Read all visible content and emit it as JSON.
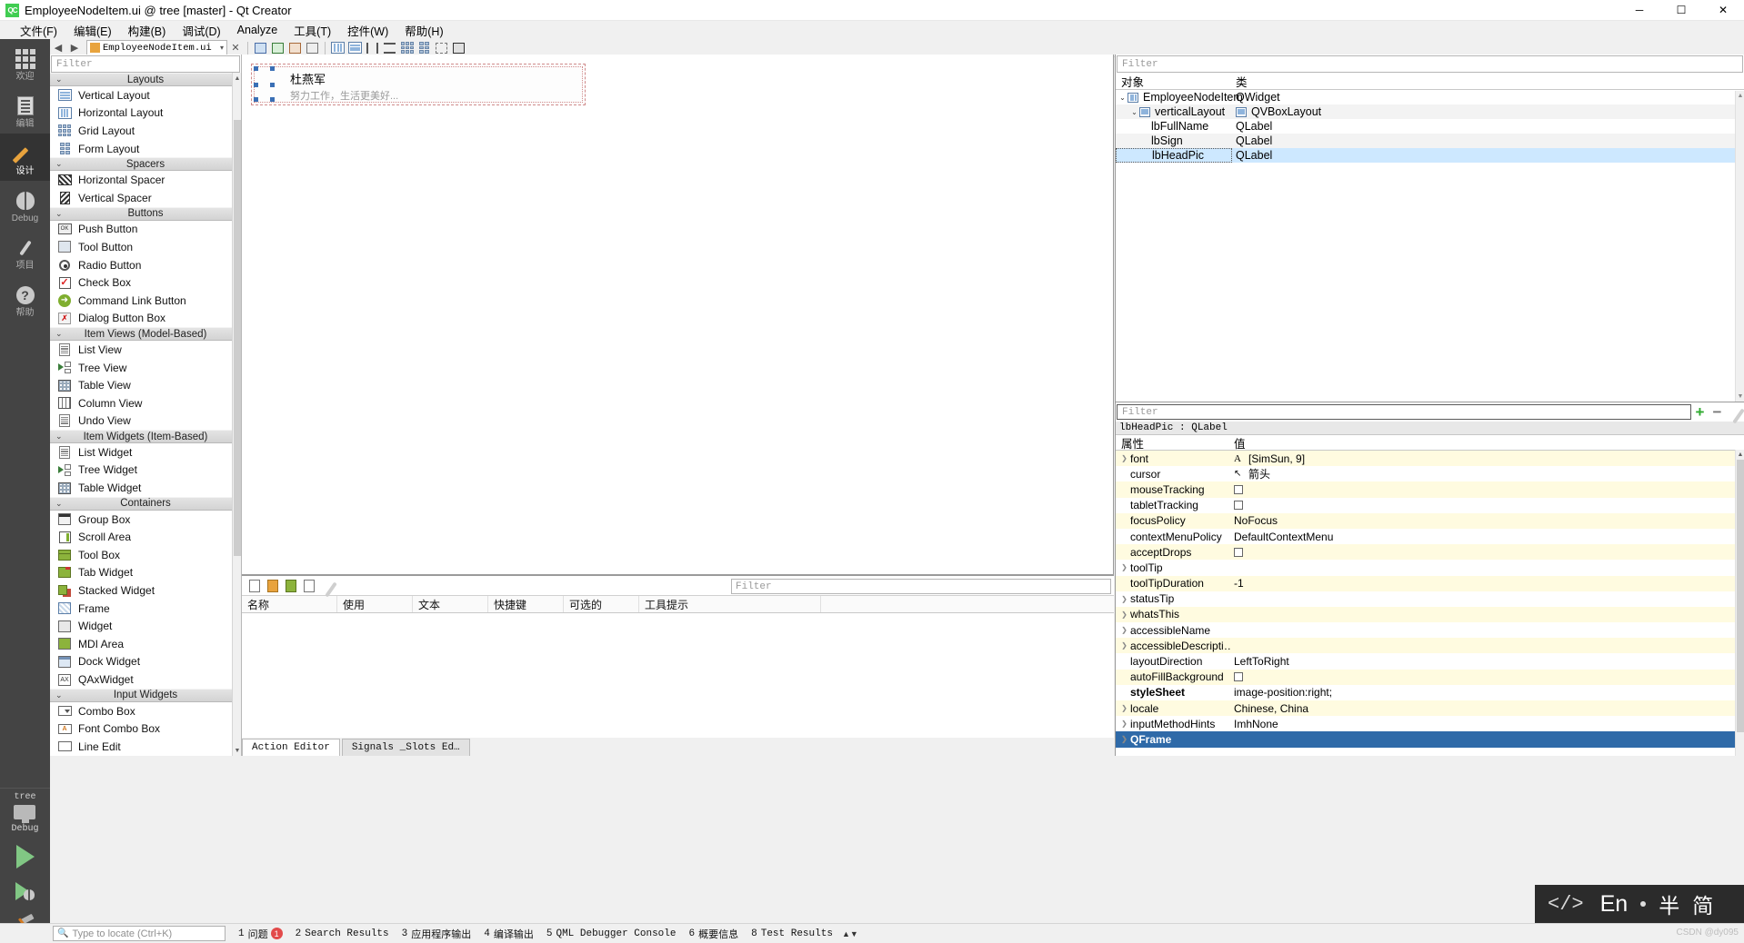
{
  "titlebar": {
    "logo": "QC",
    "title": "EmployeeNodeItem.ui @ tree [master] - Qt Creator",
    "minimize": "─",
    "maximize": "☐",
    "close": "✕"
  },
  "menubar": {
    "items": [
      {
        "label": "文件(F)"
      },
      {
        "label": "编辑(E)"
      },
      {
        "label": "构建(B)"
      },
      {
        "label": "调试(D)"
      },
      {
        "label": "Analyze"
      },
      {
        "label": "工具(T)"
      },
      {
        "label": "控件(W)"
      },
      {
        "label": "帮助(H)"
      }
    ]
  },
  "modebar": {
    "items": [
      {
        "label": "欢迎",
        "icon": "grid-icon",
        "active": false
      },
      {
        "label": "编辑",
        "icon": "document-icon",
        "active": false
      },
      {
        "label": "设计",
        "icon": "pencil-icon",
        "active": true
      },
      {
        "label": "Debug",
        "icon": "bug-icon",
        "active": false
      },
      {
        "label": "项目",
        "icon": "wrench-icon",
        "active": false
      },
      {
        "label": "帮助",
        "icon": "question-icon",
        "active": false
      }
    ],
    "kit": {
      "project": "tree",
      "config": "Debug"
    },
    "run_label": "run-button",
    "debug_label": "debug-button",
    "build_label": "build-button"
  },
  "editor_toolbar": {
    "open_file": "EmployeeNodeItem.ui",
    "close_label": "✕"
  },
  "widgetbox": {
    "filter_placeholder": "Filter",
    "groups": [
      {
        "name": "Layouts",
        "items": [
          {
            "label": "Vertical Layout",
            "icon": "vertical-layout-icon"
          },
          {
            "label": "Horizontal Layout",
            "icon": "horizontal-layout-icon"
          },
          {
            "label": "Grid Layout",
            "icon": "grid-layout-icon"
          },
          {
            "label": "Form Layout",
            "icon": "form-layout-icon"
          }
        ]
      },
      {
        "name": "Spacers",
        "items": [
          {
            "label": "Horizontal Spacer",
            "icon": "horizontal-spacer-icon"
          },
          {
            "label": "Vertical Spacer",
            "icon": "vertical-spacer-icon"
          }
        ]
      },
      {
        "name": "Buttons",
        "items": [
          {
            "label": "Push Button",
            "icon": "push-button-icon"
          },
          {
            "label": "Tool Button",
            "icon": "tool-button-icon"
          },
          {
            "label": "Radio Button",
            "icon": "radio-button-icon"
          },
          {
            "label": "Check Box",
            "icon": "check-box-icon"
          },
          {
            "label": "Command Link Button",
            "icon": "command-link-icon"
          },
          {
            "label": "Dialog Button Box",
            "icon": "dialog-button-box-icon"
          }
        ]
      },
      {
        "name": "Item Views (Model-Based)",
        "items": [
          {
            "label": "List View",
            "icon": "list-view-icon"
          },
          {
            "label": "Tree View",
            "icon": "tree-view-icon"
          },
          {
            "label": "Table View",
            "icon": "table-view-icon"
          },
          {
            "label": "Column View",
            "icon": "column-view-icon"
          },
          {
            "label": "Undo View",
            "icon": "undo-view-icon"
          }
        ]
      },
      {
        "name": "Item Widgets (Item-Based)",
        "items": [
          {
            "label": "List Widget",
            "icon": "list-widget-icon"
          },
          {
            "label": "Tree Widget",
            "icon": "tree-widget-icon"
          },
          {
            "label": "Table Widget",
            "icon": "table-widget-icon"
          }
        ]
      },
      {
        "name": "Containers",
        "items": [
          {
            "label": "Group Box",
            "icon": "group-box-icon"
          },
          {
            "label": "Scroll Area",
            "icon": "scroll-area-icon"
          },
          {
            "label": "Tool Box",
            "icon": "tool-box-icon"
          },
          {
            "label": "Tab Widget",
            "icon": "tab-widget-icon"
          },
          {
            "label": "Stacked Widget",
            "icon": "stacked-widget-icon"
          },
          {
            "label": "Frame",
            "icon": "frame-icon"
          },
          {
            "label": "Widget",
            "icon": "widget-icon"
          },
          {
            "label": "MDI Area",
            "icon": "mdi-area-icon"
          },
          {
            "label": "Dock Widget",
            "icon": "dock-widget-icon"
          },
          {
            "label": "QAxWidget",
            "icon": "qax-widget-icon"
          }
        ]
      },
      {
        "name": "Input Widgets",
        "items": [
          {
            "label": "Combo Box",
            "icon": "combo-box-icon"
          },
          {
            "label": "Font Combo Box",
            "icon": "font-combo-box-icon"
          },
          {
            "label": "Line Edit",
            "icon": "line-edit-icon"
          }
        ]
      }
    ]
  },
  "canvas": {
    "full_name": "杜燕军",
    "sign": "努力工作，生活更美好..."
  },
  "action_editor": {
    "filter_placeholder": "Filter",
    "columns": [
      "名称",
      "使用",
      "文本",
      "快捷键",
      "可选的",
      "工具提示"
    ],
    "tabs": [
      {
        "label": "Action Editor",
        "active": true
      },
      {
        "label": "Signals _Slots Ed…",
        "active": false
      }
    ]
  },
  "object_inspector": {
    "filter_placeholder": "Filter",
    "columns": {
      "name": "对象",
      "class": "类"
    },
    "rows": [
      {
        "name": "EmployeeNodeItem",
        "class": "QWidget",
        "depth": 0,
        "expandable": true,
        "icon": "hlayout-icon",
        "class_icon": false,
        "selected": false
      },
      {
        "name": "verticalLayout",
        "class": "QVBoxLayout",
        "depth": 1,
        "expandable": true,
        "icon": "vlayout-icon",
        "class_icon": true,
        "selected": false
      },
      {
        "name": "lbFullName",
        "class": "QLabel",
        "depth": 2,
        "expandable": false,
        "icon": "",
        "class_icon": false,
        "selected": false
      },
      {
        "name": "lbSign",
        "class": "QLabel",
        "depth": 2,
        "expandable": false,
        "icon": "",
        "class_icon": false,
        "selected": false
      },
      {
        "name": "lbHeadPic",
        "class": "QLabel",
        "depth": 2,
        "expandable": false,
        "icon": "",
        "class_icon": false,
        "selected": true
      }
    ]
  },
  "property_editor": {
    "filter_placeholder": "Filter",
    "object_label": "lbHeadPic : QLabel",
    "columns": {
      "property": "属性",
      "value": "值"
    },
    "add_icon": "plus-icon",
    "remove_icon": "minus-icon",
    "config_icon": "wrench-icon",
    "rows": [
      {
        "name": "font",
        "value": "[SimSun, 9]",
        "expandable": true,
        "kind": "font",
        "bold": false
      },
      {
        "name": "cursor",
        "value": "箭头",
        "expandable": false,
        "kind": "cursor",
        "bold": false
      },
      {
        "name": "mouseTracking",
        "value": "",
        "expandable": false,
        "kind": "checkbox",
        "bold": false
      },
      {
        "name": "tabletTracking",
        "value": "",
        "expandable": false,
        "kind": "checkbox",
        "bold": false
      },
      {
        "name": "focusPolicy",
        "value": "NoFocus",
        "expandable": false,
        "kind": "text",
        "bold": false
      },
      {
        "name": "contextMenuPolicy",
        "value": "DefaultContextMenu",
        "expandable": false,
        "kind": "text",
        "bold": false
      },
      {
        "name": "acceptDrops",
        "value": "",
        "expandable": false,
        "kind": "checkbox",
        "bold": false
      },
      {
        "name": "toolTip",
        "value": "",
        "expandable": true,
        "kind": "text",
        "bold": false
      },
      {
        "name": "toolTipDuration",
        "value": "-1",
        "expandable": false,
        "kind": "text",
        "bold": false
      },
      {
        "name": "statusTip",
        "value": "",
        "expandable": true,
        "kind": "text",
        "bold": false
      },
      {
        "name": "whatsThis",
        "value": "",
        "expandable": true,
        "kind": "text",
        "bold": false
      },
      {
        "name": "accessibleName",
        "value": "",
        "expandable": true,
        "kind": "text",
        "bold": false
      },
      {
        "name": "accessibleDescripti…",
        "value": "",
        "expandable": true,
        "kind": "text",
        "bold": false
      },
      {
        "name": "layoutDirection",
        "value": "LeftToRight",
        "expandable": false,
        "kind": "text",
        "bold": false
      },
      {
        "name": "autoFillBackground",
        "value": "",
        "expandable": false,
        "kind": "checkbox",
        "bold": false
      },
      {
        "name": "styleSheet",
        "value": "image-position:right;",
        "expandable": false,
        "kind": "text",
        "bold": true
      },
      {
        "name": "locale",
        "value": "Chinese, China",
        "expandable": true,
        "kind": "text",
        "bold": false
      },
      {
        "name": "inputMethodHints",
        "value": "ImhNone",
        "expandable": true,
        "kind": "text",
        "bold": false
      },
      {
        "name": "QFrame",
        "value": "",
        "expandable": true,
        "kind": "group",
        "bold": true
      }
    ]
  },
  "statusbar": {
    "locator_placeholder": "Type to locate (Ctrl+K)",
    "items": [
      {
        "num": "1",
        "label": "问题",
        "badge": "1"
      },
      {
        "num": "2",
        "label": "Search Results",
        "badge": ""
      },
      {
        "num": "3",
        "label": "应用程序输出",
        "badge": ""
      },
      {
        "num": "4",
        "label": "编译输出",
        "badge": ""
      },
      {
        "num": "5",
        "label": "QML Debugger Console",
        "badge": ""
      },
      {
        "num": "6",
        "label": "概要信息",
        "badge": ""
      },
      {
        "num": "8",
        "label": "Test Results",
        "badge": ""
      }
    ]
  },
  "ime": {
    "code_icon": "</>",
    "lang": "En",
    "width_mode": "半",
    "script_mode": "简"
  },
  "watermark": "CSDN @dy095"
}
